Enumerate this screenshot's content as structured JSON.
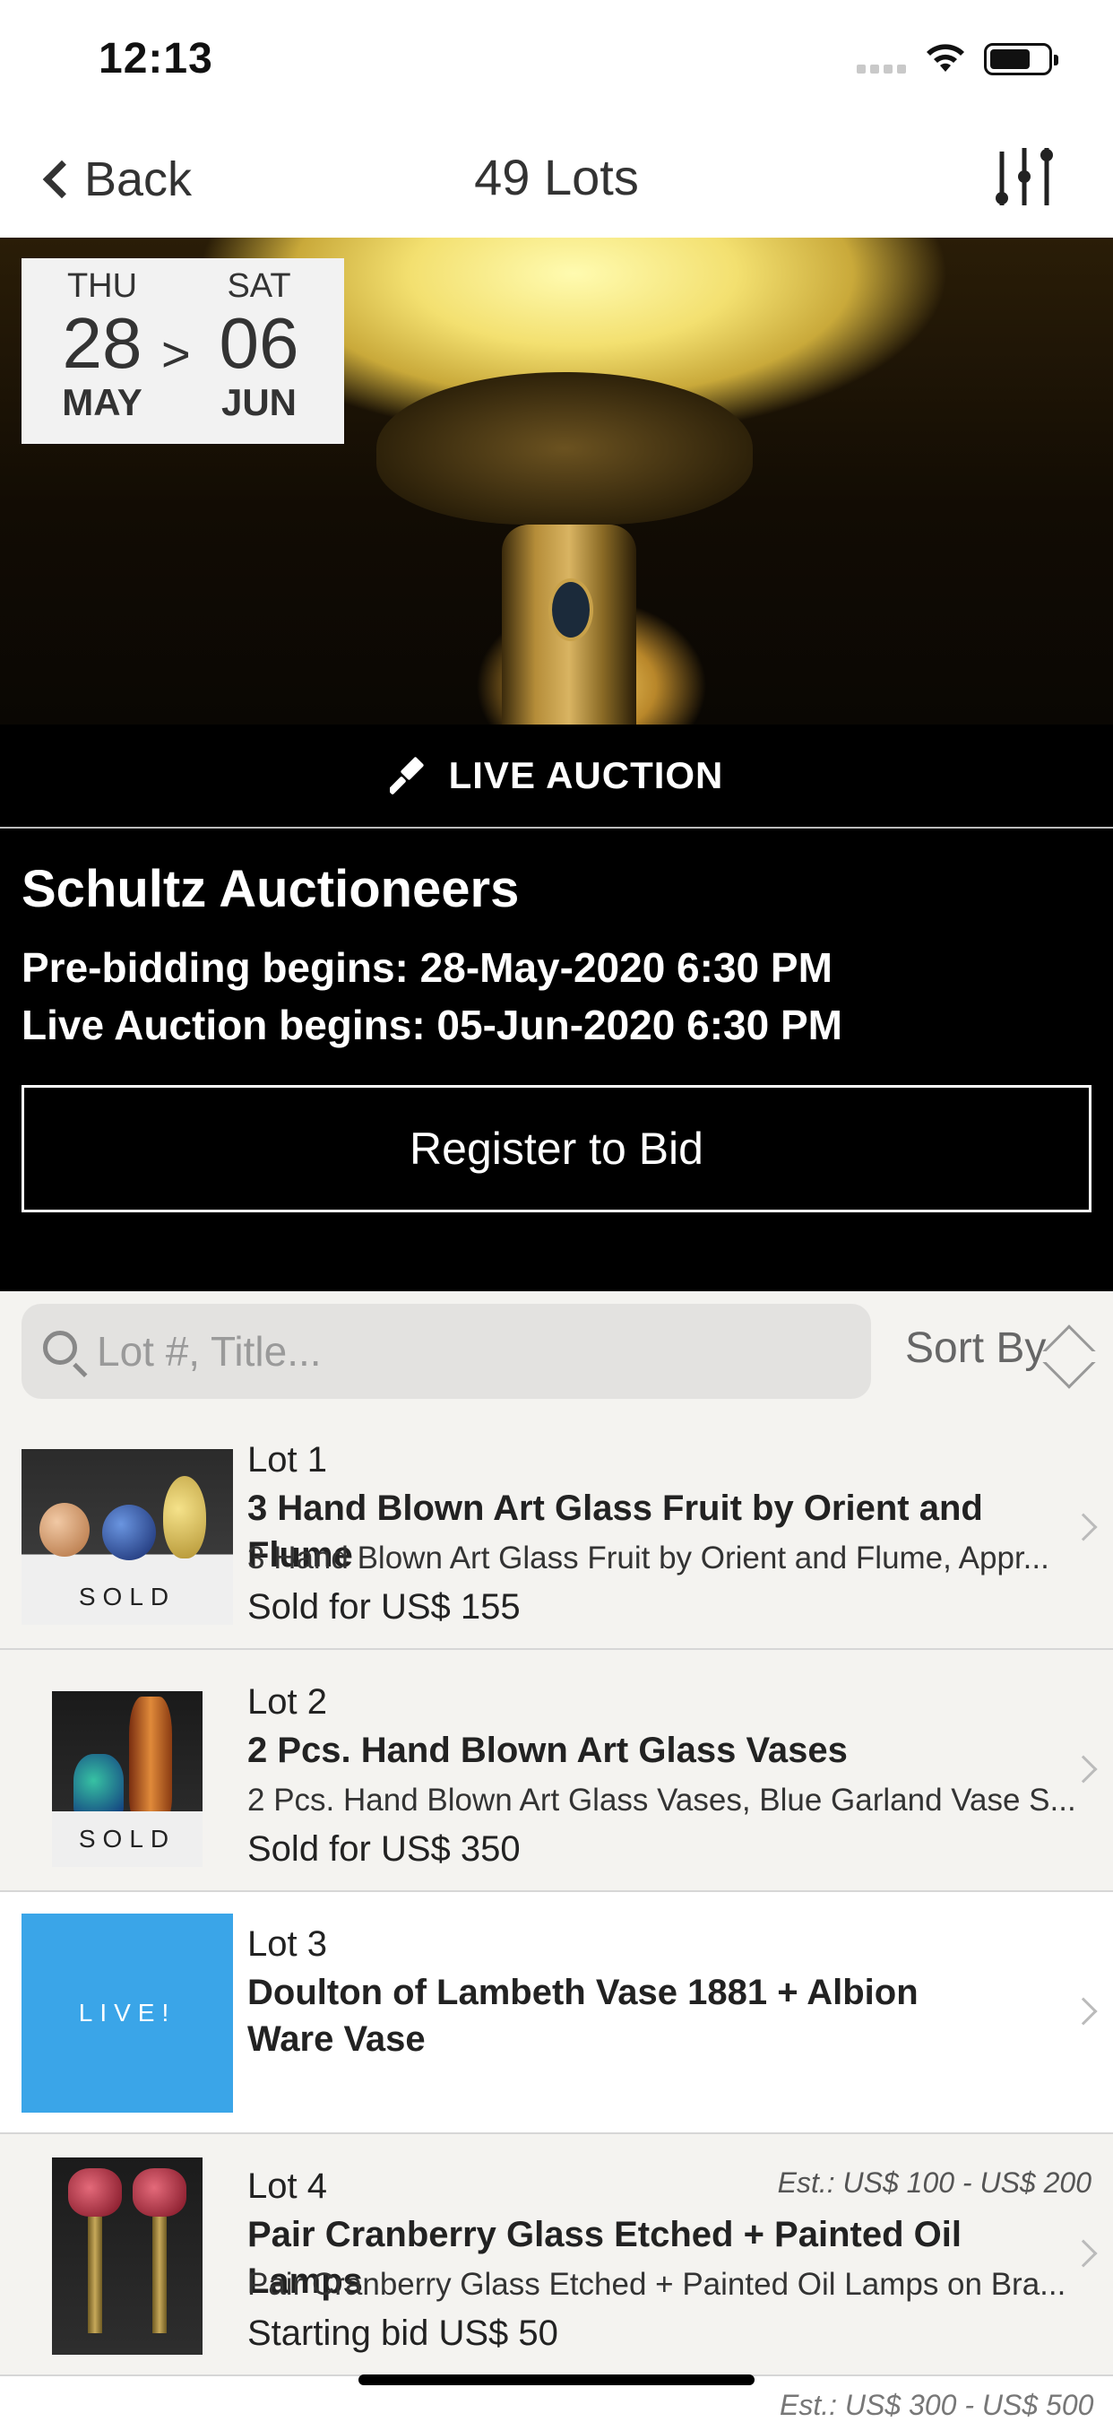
{
  "status_bar": {
    "time": "12:13"
  },
  "nav": {
    "back_label": "Back",
    "title": "49 Lots"
  },
  "hero": {
    "start": {
      "dow": "THU",
      "day": "28",
      "month": "MAY"
    },
    "separator": ">",
    "end": {
      "dow": "SAT",
      "day": "06",
      "month": "JUN"
    }
  },
  "live_banner": {
    "label": "LIVE AUCTION",
    "icon": "gavel-icon"
  },
  "auction": {
    "house": "Schultz Auctioneers",
    "prebid": "Pre-bidding begins: 28-May-2020 6:30 PM",
    "live_begins": "Live Auction begins: 05-Jun-2020 6:30 PM",
    "register_label": "Register to Bid"
  },
  "search": {
    "placeholder": "Lot #, Title...",
    "value": "",
    "sort_label": "Sort By"
  },
  "lots": [
    {
      "lot": "Lot 1",
      "title": "3 Hand Blown Art Glass Fruit by Orient and Flume",
      "desc": "3 Hand Blown Art Glass Fruit by Orient and Flume, Appr...",
      "price": "Sold for US$ 155",
      "badge": "SOLD"
    },
    {
      "lot": "Lot 2",
      "title": "2 Pcs. Hand Blown Art Glass Vases",
      "desc": "2 Pcs. Hand Blown Art Glass Vases, Blue Garland Vase S...",
      "price": "Sold for US$ 350",
      "badge": "SOLD"
    },
    {
      "lot": "Lot 3",
      "title": "Doulton of Lambeth Vase 1881 + Albion Ware Vase",
      "badge": "LIVE!"
    },
    {
      "lot": "Lot 4",
      "estimate": "Est.: US$ 100 - US$ 200",
      "title": "Pair Cranberry Glass Etched + Painted Oil Lamps",
      "desc": "Pair Cranberry Glass Etched + Painted Oil Lamps on Bra...",
      "price": "Starting bid US$ 50"
    }
  ],
  "partial_next_estimate": "Est.: US$ 300 - US$ 500",
  "colors": {
    "accent_live": "#3aa5e8",
    "banner_bg": "#000000"
  }
}
